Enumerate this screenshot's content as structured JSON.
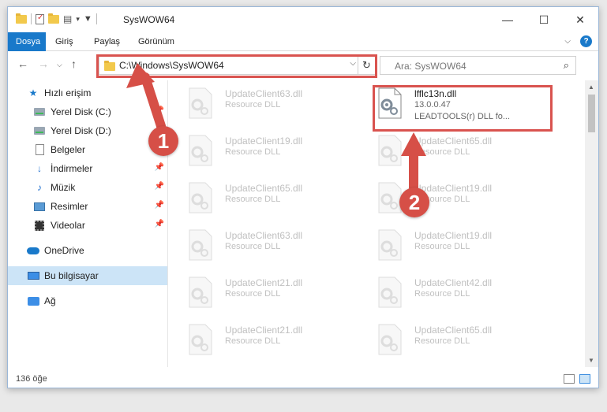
{
  "window": {
    "title": "SysWOW64",
    "controls": {
      "minimize": "—",
      "maximize": "☐",
      "close": "✕"
    }
  },
  "ribbon": {
    "tabs": [
      "Dosya",
      "Giriş",
      "Paylaş",
      "Görünüm"
    ],
    "active_tab": "Dosya",
    "accent": "#1979ca"
  },
  "navigation": {
    "address": "C:\\Windows\\SysWOW64",
    "search_placeholder": "Ara: SysWOW64"
  },
  "sidebar": {
    "items": [
      {
        "label": "Hızlı erişim",
        "icon": "star-icon",
        "pinned": false
      },
      {
        "label": "Yerel Disk (C:)",
        "icon": "drive-icon",
        "pinned": true
      },
      {
        "label": "Yerel Disk (D:)",
        "icon": "drive-icon",
        "pinned": true
      },
      {
        "label": "Belgeler",
        "icon": "document-icon",
        "pinned": true
      },
      {
        "label": "İndirmeler",
        "icon": "download-icon",
        "pinned": true
      },
      {
        "label": "Müzik",
        "icon": "music-icon",
        "pinned": true
      },
      {
        "label": "Resimler",
        "icon": "pictures-icon",
        "pinned": true
      },
      {
        "label": "Videolar",
        "icon": "videos-icon",
        "pinned": true
      },
      {
        "label": "OneDrive",
        "icon": "cloud-icon",
        "pinned": false
      },
      {
        "label": "Bu bilgisayar",
        "icon": "computer-icon",
        "pinned": false,
        "selected": true
      },
      {
        "label": "Ağ",
        "icon": "network-icon",
        "pinned": false
      }
    ]
  },
  "files": {
    "left_column": [
      {
        "name": "UpdateClient63.dll",
        "desc": "Resource DLL"
      },
      {
        "name": "UpdateClient19.dll",
        "desc": "Resource DLL"
      },
      {
        "name": "UpdateClient65.dll",
        "desc": "Resource DLL"
      },
      {
        "name": "UpdateClient63.dll",
        "desc": "Resource DLL"
      },
      {
        "name": "UpdateClient21.dll",
        "desc": "Resource DLL"
      },
      {
        "name": "UpdateClient21.dll",
        "desc": "Resource DLL"
      }
    ],
    "right_column": [
      {
        "name": "lfflc13n.dll",
        "version": "13.0.0.47",
        "desc": "LEADTOOLS(r) DLL fo...",
        "focused": true
      },
      {
        "name": "UpdateClient65.dll",
        "desc": "Resource DLL"
      },
      {
        "name": "UpdateClient19.dll",
        "desc": "Resource DLL"
      },
      {
        "name": "UpdateClient19.dll",
        "desc": "Resource DLL"
      },
      {
        "name": "UpdateClient42.dll",
        "desc": "Resource DLL"
      },
      {
        "name": "UpdateClient65.dll",
        "desc": "Resource DLL"
      }
    ]
  },
  "status": {
    "item_count": "136 öğe"
  },
  "annotations": {
    "callout_1": "1",
    "callout_2": "2",
    "color": "#d64f47"
  }
}
